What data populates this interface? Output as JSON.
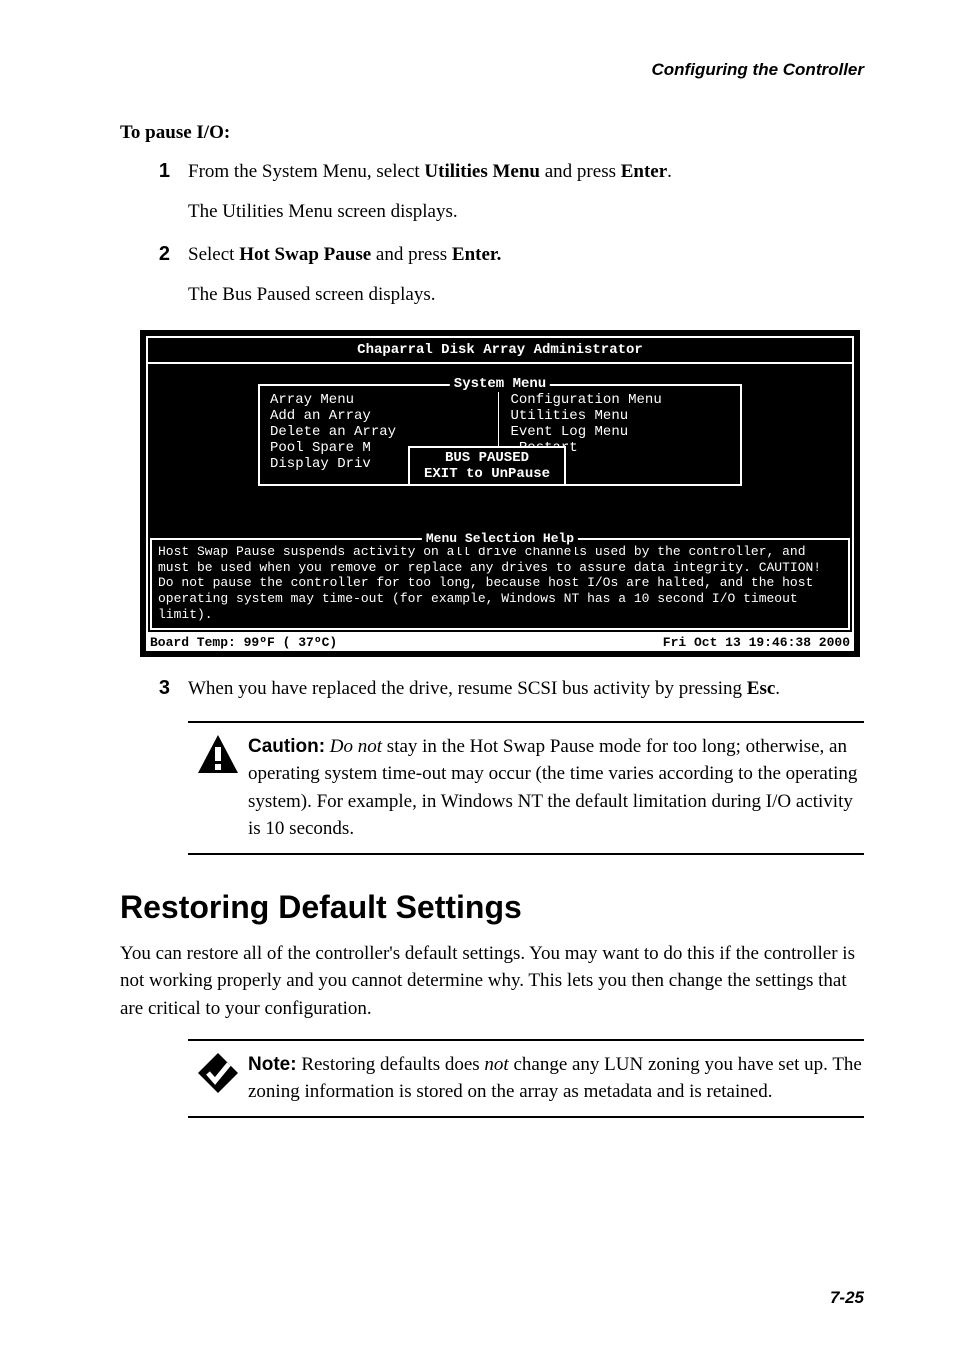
{
  "header": {
    "running_title": "Configuring the Controller"
  },
  "intro": {
    "heading": "To pause I/O:"
  },
  "steps": [
    {
      "num": "1",
      "line1_pre": "From the System Menu, select ",
      "line1_b1": "Utilities Menu",
      "line1_mid": " and press ",
      "line1_b2": "Enter",
      "line1_post": ".",
      "line2": "The Utilities Menu screen displays."
    },
    {
      "num": "2",
      "line1_pre": "Select ",
      "line1_b1": "Hot Swap Pause",
      "line1_mid": " and press ",
      "line1_b2": "Enter.",
      "line1_post": "",
      "line2": "The Bus Paused screen displays."
    },
    {
      "num": "3",
      "line1_pre": "When you have replaced the drive, resume SCSI bus activity by pressing ",
      "line1_b1": "Esc",
      "line1_mid": "",
      "line1_b2": "",
      "line1_post": ".",
      "line2": ""
    }
  ],
  "terminal": {
    "title": "Chaparral Disk Array Administrator",
    "system_menu_label": "System Menu",
    "left_items": "Array Menu\nAdd an Array\nDelete an Array\nPool Spare M\nDisplay Driv",
    "right_items": "Configuration Menu\nUtilities Menu\nEvent Log Menu\n Restart",
    "dialog_line1": "BUS PAUSED",
    "dialog_line2": "EXIT to UnPause",
    "help_label": "Menu Selection Help",
    "help_text": "Host Swap Pause suspends activity on all drive channels used by the controller, and must be used when you remove or replace any drives to assure data integrity.  CAUTION!  Do not pause the controller for too long, because host I/Os are halted, and the host operating system may time-out (for example, Windows NT has a 10 second I/O timeout limit).",
    "status_left": "Board Temp:  99ºF ( 37ºC)",
    "status_right": "Fri Oct 13 19:46:38 2000"
  },
  "caution": {
    "label": "Caution:",
    "italic": "Do not",
    "rest": " stay in the Hot Swap Pause mode for too long; otherwise, an operating system time-out may occur (the time varies according to the operating system). For example, in Windows NT the default limitation during I/O activity is 10 seconds."
  },
  "section": {
    "title": "Restoring Default Settings"
  },
  "section_para": "You can restore all of the controller's default settings. You may want to do this if the controller is not working properly and you cannot determine why. This lets you then change the settings that are critical to your configuration.",
  "note": {
    "label": "Note:",
    "pre": " Restoring defaults does ",
    "italic": "not",
    "post": " change any LUN zoning you have set up. The zoning information is stored on the array as metadata and is retained."
  },
  "footer": {
    "page": "7-25"
  }
}
